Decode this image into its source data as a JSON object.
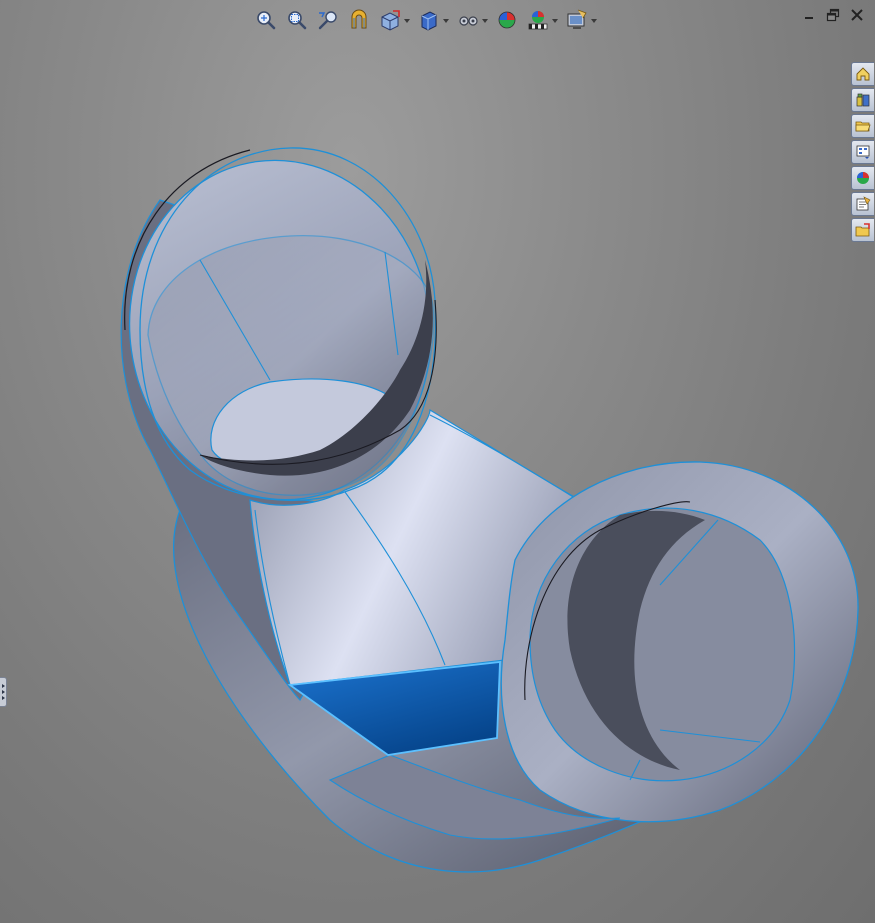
{
  "window": {
    "title": "",
    "controls": [
      {
        "name": "minimize-icon",
        "action": "minimize"
      },
      {
        "name": "restore-icon",
        "action": "restore"
      },
      {
        "name": "close-icon",
        "action": "close"
      }
    ]
  },
  "hud_toolbar": {
    "buttons": [
      {
        "name": "zoom-to-fit-icon",
        "has_menu": false
      },
      {
        "name": "zoom-to-area-icon",
        "has_menu": false
      },
      {
        "name": "previous-view-icon",
        "has_menu": false
      },
      {
        "name": "section-view-icon",
        "has_menu": false
      },
      {
        "name": "view-orientation-icon",
        "has_menu": true
      },
      {
        "name": "display-style-icon",
        "has_menu": true
      },
      {
        "name": "hide-show-items-icon",
        "has_menu": true
      },
      {
        "name": "edit-appearance-icon",
        "has_menu": false
      },
      {
        "name": "apply-scene-icon",
        "has_menu": true
      },
      {
        "name": "view-settings-icon",
        "has_menu": true
      }
    ]
  },
  "task_pane": {
    "tabs": [
      {
        "name": "resources-home-icon"
      },
      {
        "name": "design-library-icon"
      },
      {
        "name": "file-explorer-icon"
      },
      {
        "name": "view-palette-icon"
      },
      {
        "name": "appearances-scenes-icon"
      },
      {
        "name": "custom-properties-icon"
      },
      {
        "name": "document-recovery-icon"
      }
    ]
  },
  "model": {
    "selected_face": "planar-face",
    "colors": {
      "surface": "#a8aec2",
      "surface_dark": "#4a4e5c",
      "edge": "#1e90d8",
      "selected_face": "#0a5cb0",
      "background": "#8a8a8a"
    }
  }
}
